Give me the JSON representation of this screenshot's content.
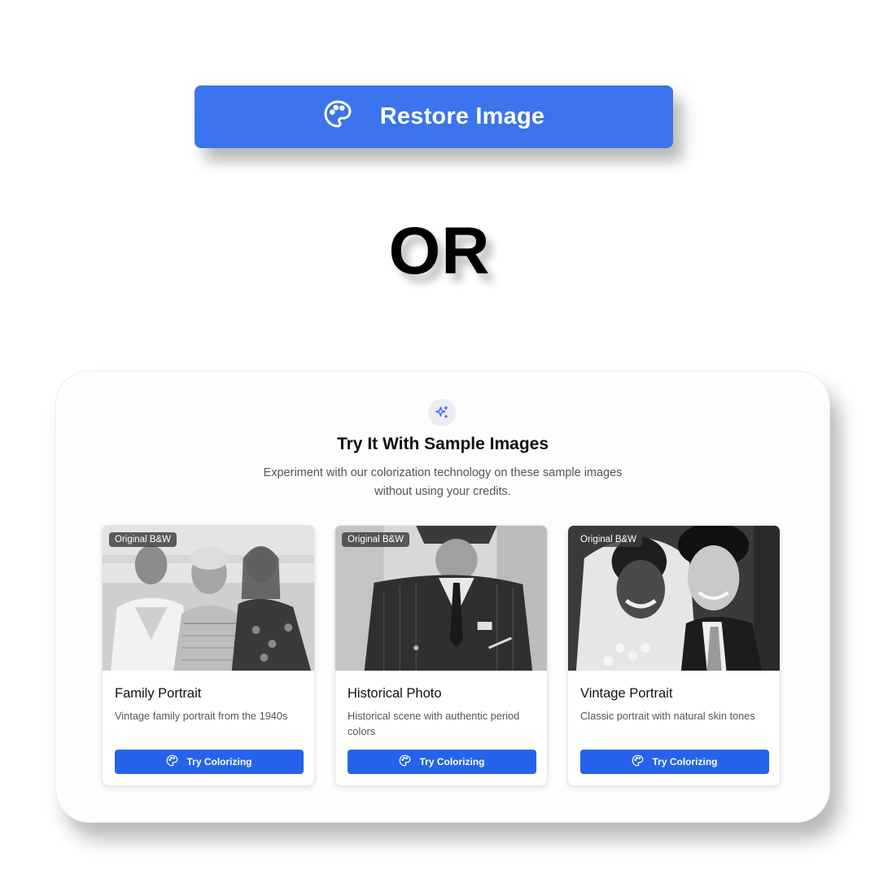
{
  "restore_button": {
    "label": "Restore Image",
    "icon": "palette-icon"
  },
  "separator": "OR",
  "samples": {
    "icon": "sparkles-icon",
    "title": "Try It With Sample Images",
    "subtitle_line1": "Experiment with our colorization technology on these sample images",
    "subtitle_line2": "without using your credits.",
    "cards": [
      {
        "badge": "Original B&W",
        "title": "Family Portrait",
        "description": "Vintage family portrait from the 1940s",
        "button": "Try Colorizing"
      },
      {
        "badge": "Original B&W",
        "title": "Historical Photo",
        "description": "Historical scene with authentic period colors",
        "button": "Try Colorizing"
      },
      {
        "badge": "Original B&W",
        "title": "Vintage Portrait",
        "description": "Classic portrait with natural skin tones",
        "button": "Try Colorizing"
      }
    ]
  },
  "colors": {
    "restore_blue": "#3b74ec",
    "button_blue": "#2563eb",
    "sparkle_blue": "#4a6cf7"
  }
}
